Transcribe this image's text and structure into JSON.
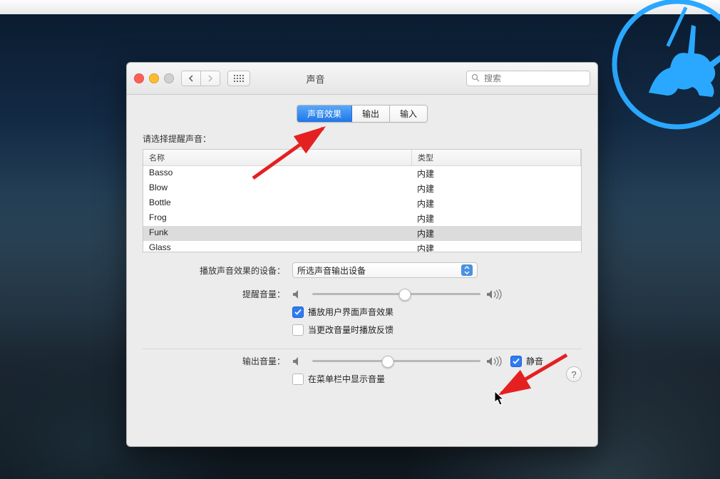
{
  "window": {
    "title": "声音",
    "search_placeholder": "搜索"
  },
  "tabs": [
    {
      "label": "声音效果",
      "active": true
    },
    {
      "label": "输出",
      "active": false
    },
    {
      "label": "输入",
      "active": false
    }
  ],
  "alert_sound": {
    "section_label": "请选择提醒声音：",
    "columns": {
      "name": "名称",
      "type": "类型"
    },
    "rows": [
      {
        "name": "Basso",
        "type": "内建",
        "selected": false
      },
      {
        "name": "Blow",
        "type": "内建",
        "selected": false
      },
      {
        "name": "Bottle",
        "type": "内建",
        "selected": false
      },
      {
        "name": "Frog",
        "type": "内建",
        "selected": false
      },
      {
        "name": "Funk",
        "type": "内建",
        "selected": true
      },
      {
        "name": "Glass",
        "type": "内建",
        "selected": false
      }
    ]
  },
  "play_through": {
    "label": "播放声音效果的设备：",
    "value": "所选声音输出设备"
  },
  "alert_volume": {
    "label": "提醒音量：",
    "percent": 55
  },
  "checkboxes": {
    "ui_sound": {
      "label": "播放用户界面声音效果",
      "checked": true
    },
    "feedback": {
      "label": "当更改音量时播放反馈",
      "checked": false
    }
  },
  "output_volume": {
    "label": "输出音量：",
    "percent": 45,
    "mute": {
      "label": "静音",
      "checked": true
    }
  },
  "menu_bar": {
    "label": "在菜单栏中显示音量",
    "checked": false
  },
  "colors": {
    "accent": "#2f7bf6"
  }
}
